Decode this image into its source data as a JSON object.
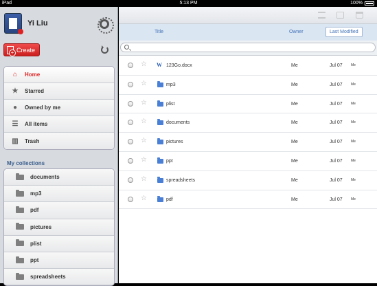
{
  "statusbar": {
    "carrier": "iPad",
    "time": "5:13 PM",
    "battery": "100%"
  },
  "user": {
    "name": "Yi Liu"
  },
  "create_label": "Create",
  "nav": [
    {
      "label": "Home",
      "icon": "home-icon",
      "active": true
    },
    {
      "label": "Starred",
      "icon": "star-icon"
    },
    {
      "label": "Owned by me",
      "icon": "person-icon"
    },
    {
      "label": "All items",
      "icon": "list-icon"
    },
    {
      "label": "Trash",
      "icon": "trash-icon"
    }
  ],
  "collections_title": "My collections",
  "collections": [
    "documents",
    "mp3",
    "pdf",
    "pictures",
    "plist",
    "ppt",
    "spreadsheets"
  ],
  "columns": {
    "title": "Title",
    "owner": "Owner",
    "last_modified": "Last Modified"
  },
  "search": {
    "value": "",
    "placeholder": ""
  },
  "files": [
    {
      "name": "123Go.docx",
      "type": "doc",
      "owner": "Me",
      "date": "Jul 07",
      "by": "Me"
    },
    {
      "name": "mp3",
      "type": "folder",
      "owner": "Me",
      "date": "Jul 07",
      "by": "Me"
    },
    {
      "name": "plist",
      "type": "folder",
      "owner": "Me",
      "date": "Jul 07",
      "by": "Me"
    },
    {
      "name": "documents",
      "type": "folder",
      "owner": "Me",
      "date": "Jul 07",
      "by": "Me"
    },
    {
      "name": "pictures",
      "type": "folder",
      "owner": "Me",
      "date": "Jul 07",
      "by": "Me"
    },
    {
      "name": "ppt",
      "type": "folder",
      "owner": "Me",
      "date": "Jul 07",
      "by": "Me"
    },
    {
      "name": "spreadsheets",
      "type": "folder",
      "owner": "Me",
      "date": "Jul 07",
      "by": "Me"
    },
    {
      "name": "pdf",
      "type": "folder",
      "owner": "Me",
      "date": "Jul 07",
      "by": "Me"
    }
  ],
  "colors": {
    "accent_red": "#d22222",
    "link_blue": "#3f70b5",
    "folder_blue": "#4a7fd6"
  }
}
